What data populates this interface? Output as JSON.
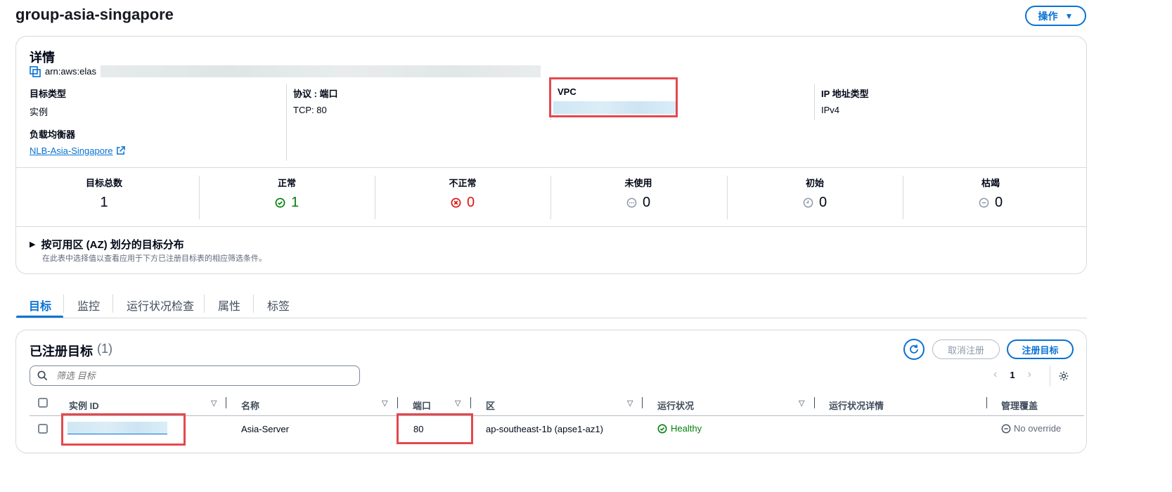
{
  "header": {
    "title": "group-asia-singapore",
    "actions_label": "操作"
  },
  "details": {
    "heading": "详情",
    "arn_prefix": "arn:aws:elas",
    "fields": {
      "target_type": {
        "label": "目标类型",
        "value": "实例"
      },
      "protocol_port": {
        "label": "协议 : 端口",
        "value": "TCP: 80"
      },
      "vpc": {
        "label": "VPC"
      },
      "ip_type": {
        "label": "IP 地址类型",
        "value": "IPv4"
      },
      "load_balancer": {
        "label": "负载均衡器",
        "value": "NLB-Asia-Singapore"
      }
    }
  },
  "summary": [
    {
      "label": "目标总数",
      "value": "1"
    },
    {
      "label": "正常",
      "value": "1"
    },
    {
      "label": "不正常",
      "value": "0"
    },
    {
      "label": "未使用",
      "value": "0"
    },
    {
      "label": "初始",
      "value": "0"
    },
    {
      "label": "枯竭",
      "value": "0"
    }
  ],
  "colors": {
    "healthy": "#037f0c",
    "unhealthy": "#d91515",
    "neutral": "#5f6b7a",
    "accent": "#0972d3"
  },
  "az_section": {
    "title": "按可用区 (AZ) 划分的目标分布",
    "description": "在此表中选择值以查看应用于下方已注册目标表的相应筛选条件。"
  },
  "tabs": [
    "目标",
    "监控",
    "运行状况检查",
    "属性",
    "标签"
  ],
  "targets": {
    "heading": "已注册目标",
    "count": "(1)",
    "deregister_label": "取消注册",
    "register_label": "注册目标",
    "filter_placeholder": "筛选 目标",
    "page": "1",
    "columns": [
      "实例 ID",
      "名称",
      "端口",
      "区",
      "运行状况",
      "运行状况详情",
      "管理覆盖"
    ],
    "rows": [
      {
        "name": "Asia-Server",
        "port": "80",
        "zone": "ap-southeast-1b (apse1-az1)",
        "health": "Healthy",
        "override": "No override"
      }
    ]
  }
}
